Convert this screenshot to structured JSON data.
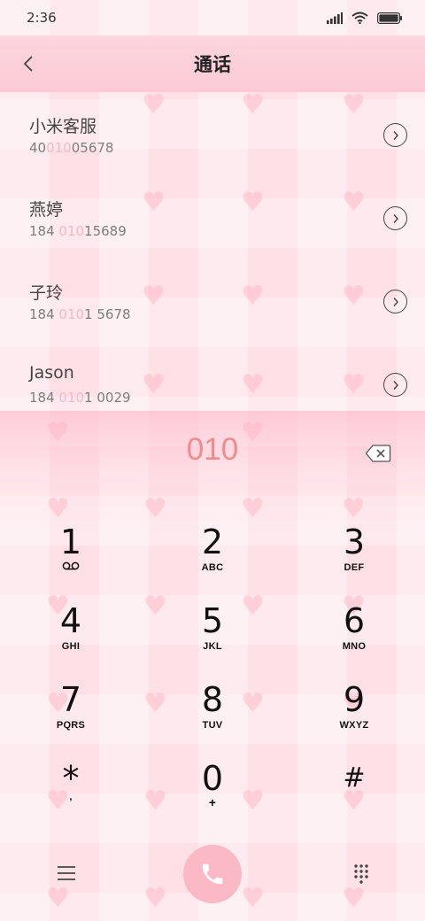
{
  "status_bar": {
    "time": "2:36"
  },
  "header": {
    "title": "通话"
  },
  "contacts": [
    {
      "name": "小米客服",
      "number_prefix": "40",
      "number_match": "010",
      "number_suffix": "05678"
    },
    {
      "name": "燕婷",
      "number_prefix": "184 ",
      "number_match": "010",
      "number_suffix": "15689"
    },
    {
      "name": "子玲",
      "number_prefix": "184 ",
      "number_match": "010",
      "number_suffix": "1 5678"
    },
    {
      "name": "Jason",
      "number_prefix": "184 ",
      "number_match": "010",
      "number_suffix": "1 0029"
    }
  ],
  "dialer": {
    "input": "010",
    "keys": [
      {
        "digit": "1",
        "letters": ""
      },
      {
        "digit": "2",
        "letters": "ABC"
      },
      {
        "digit": "3",
        "letters": "DEF"
      },
      {
        "digit": "4",
        "letters": "GHI"
      },
      {
        "digit": "5",
        "letters": "JKL"
      },
      {
        "digit": "6",
        "letters": "MNO"
      },
      {
        "digit": "7",
        "letters": "PQRS"
      },
      {
        "digit": "8",
        "letters": "TUV"
      },
      {
        "digit": "9",
        "letters": "WXYZ"
      },
      {
        "digit": "*",
        "letters": ","
      },
      {
        "digit": "0",
        "letters": "+"
      },
      {
        "digit": "#",
        "letters": ""
      }
    ]
  },
  "icons": {
    "back": "chevron-left-icon",
    "detail": "chevron-right-circle-icon",
    "backspace": "backspace-icon",
    "voicemail": "voicemail-icon",
    "menu": "menu-icon",
    "call": "phone-icon",
    "keypad": "dialpad-icon",
    "signal": "signal-icon",
    "wifi": "wifi-icon",
    "battery": "battery-icon"
  },
  "colors": {
    "accent": "#f28b8e",
    "match_highlight": "#f8b7c4",
    "call_button": "#fbb9c6",
    "header_bg": "#fccbd6"
  }
}
